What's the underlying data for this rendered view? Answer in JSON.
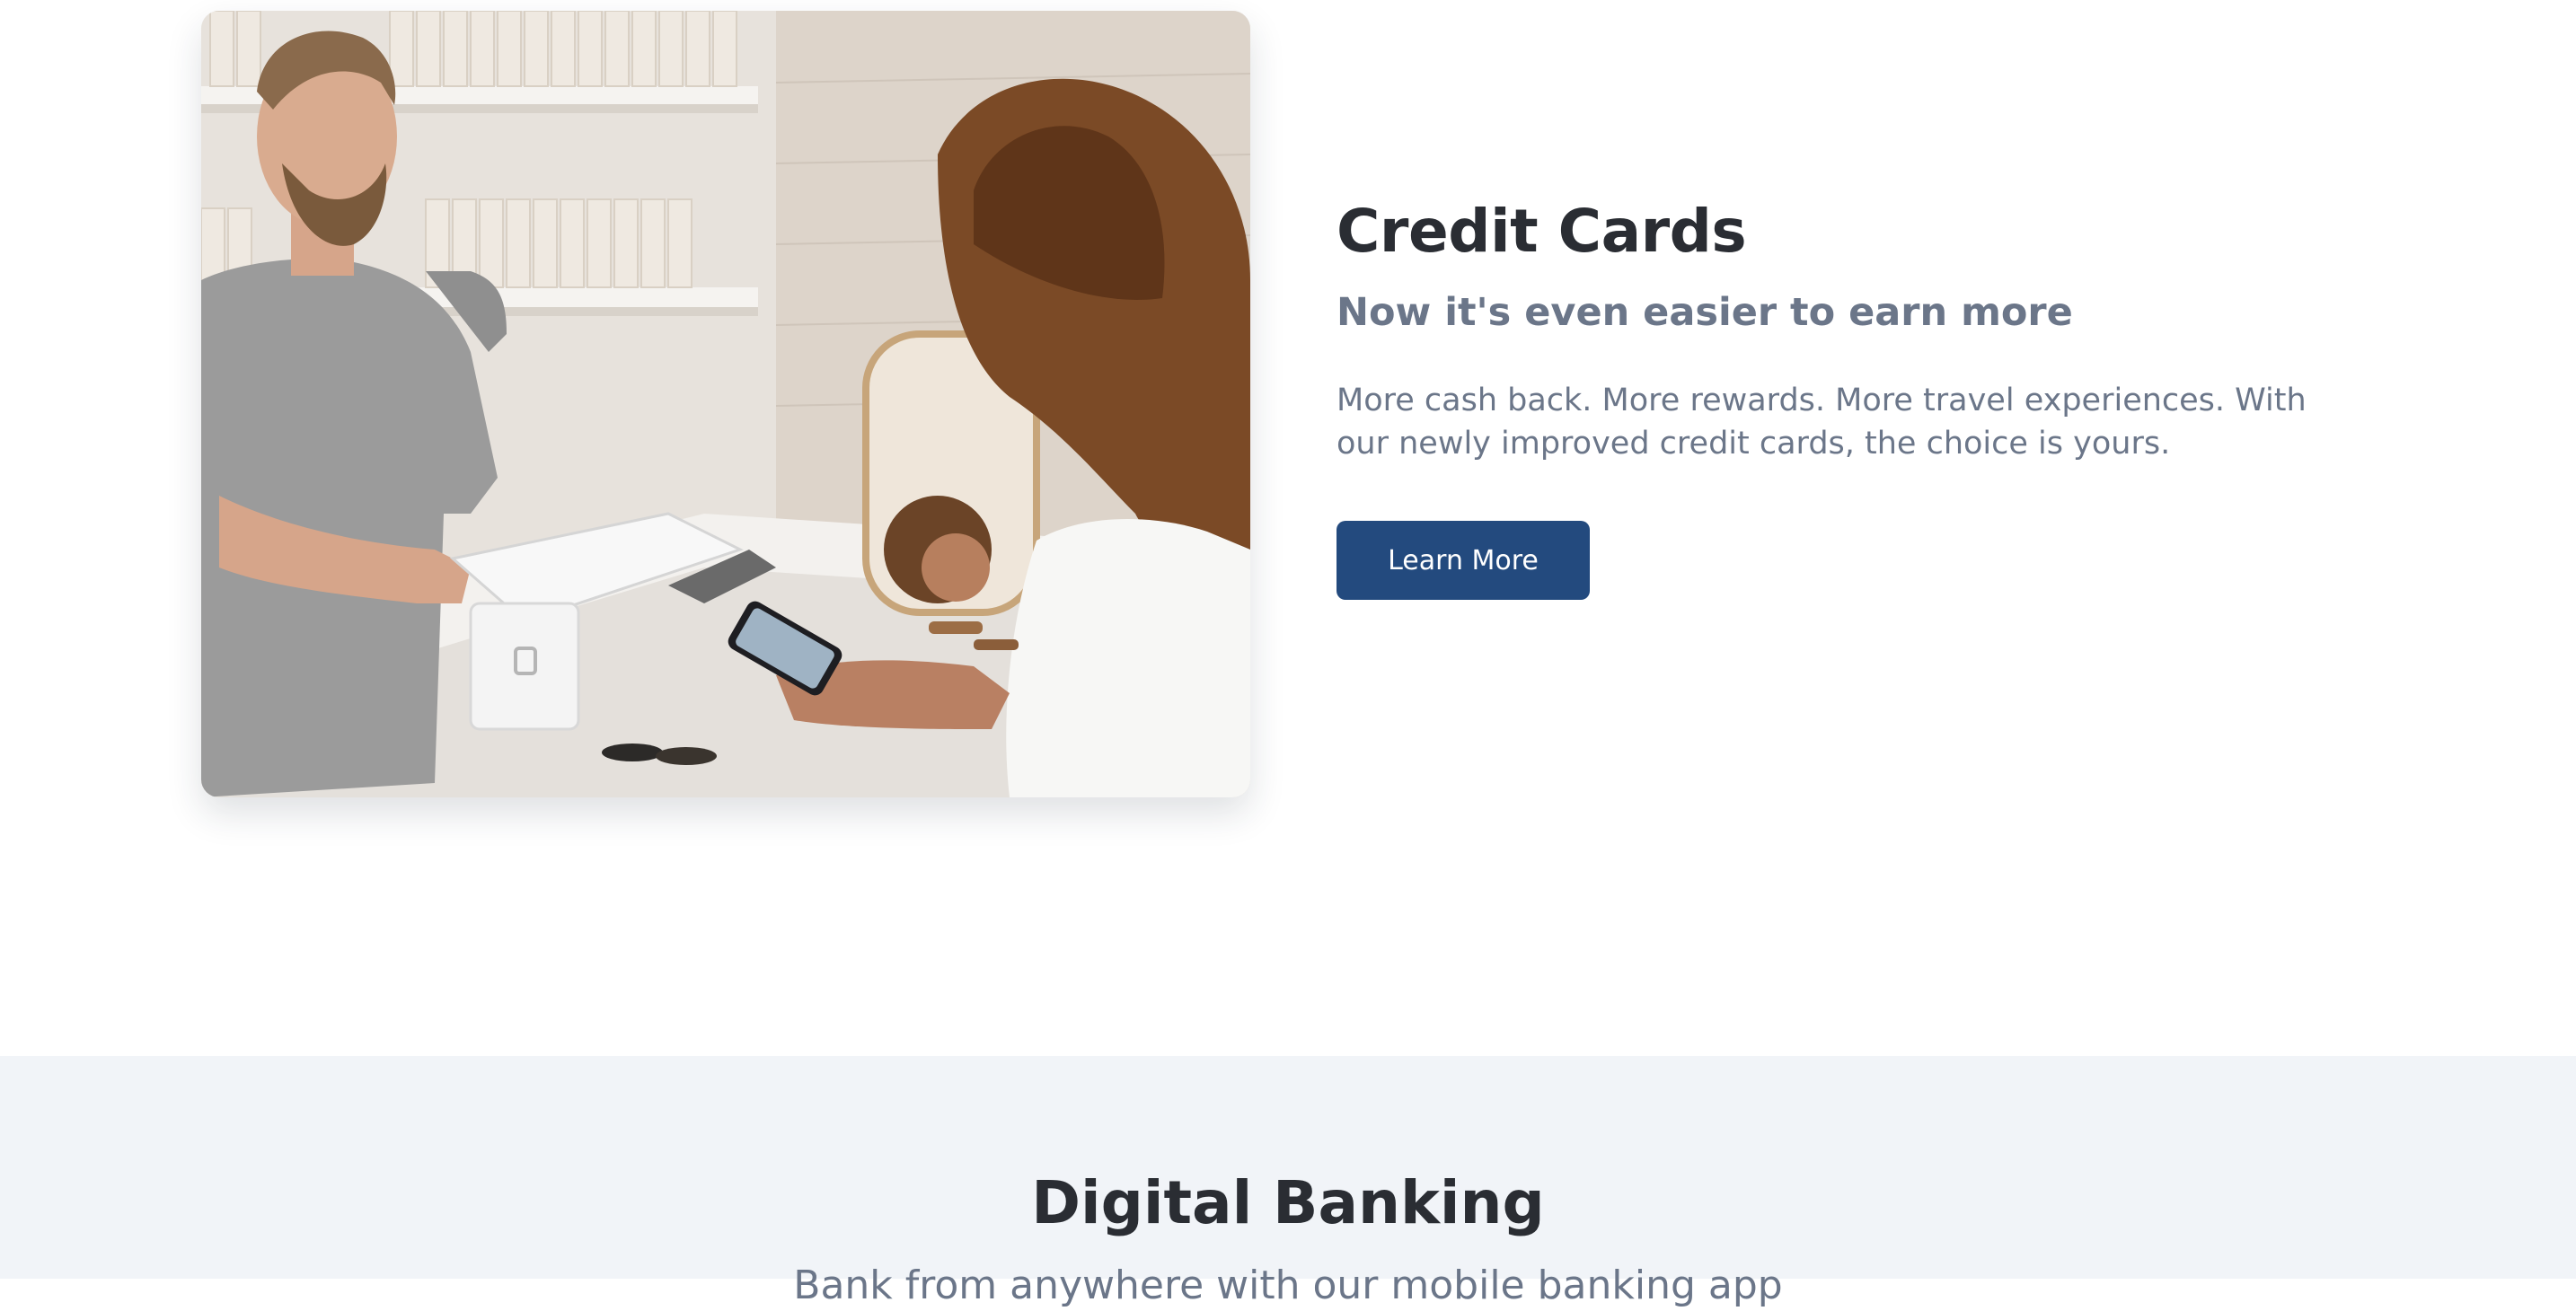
{
  "feature": {
    "image": {
      "alt": "Customer paying with a phone at a shop counter",
      "icon": "photo-icon"
    },
    "title": "Credit Cards",
    "subtitle": "Now it's even easier to earn more",
    "body": "More cash back. More rewards. More travel experiences. With our newly improved credit cards, the choice is yours.",
    "cta_label": "Learn More"
  },
  "digital_banking": {
    "title": "Digital Banking",
    "subtitle": "Bank from anywhere with our mobile banking app"
  },
  "colors": {
    "primary_button": "#234a7e",
    "heading": "#2a2d33",
    "muted_text": "#6b7689",
    "section_bg": "#f1f4f8"
  }
}
